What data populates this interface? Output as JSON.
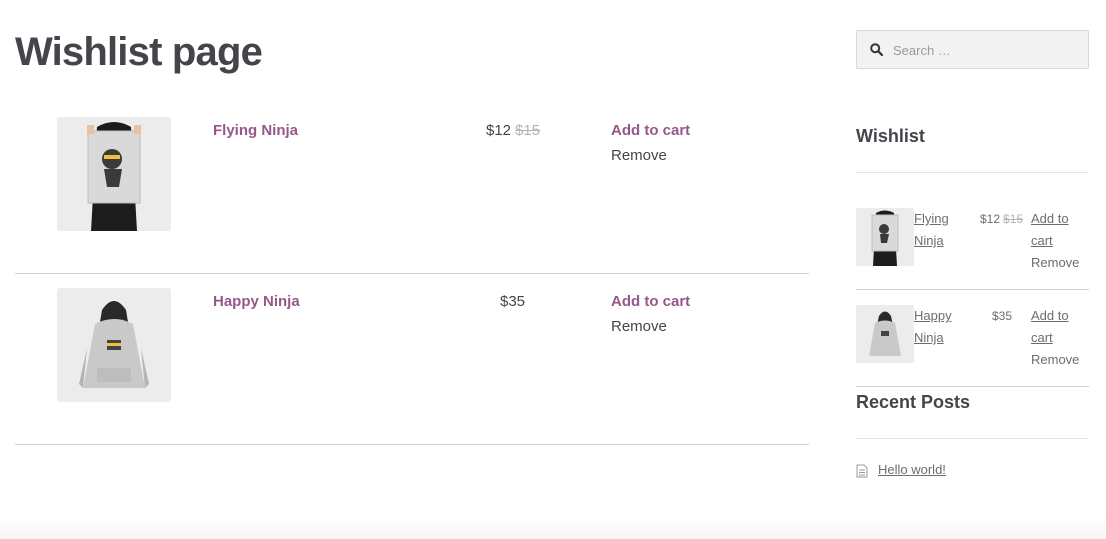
{
  "page": {
    "title": "Wishlist page"
  },
  "items": [
    {
      "name": "Flying Ninja",
      "price": "$12",
      "old_price": "$15",
      "add_label": "Add to cart",
      "remove_label": "Remove"
    },
    {
      "name": "Happy Ninja",
      "price": "$35",
      "old_price": "",
      "add_label": "Add to cart",
      "remove_label": "Remove"
    }
  ],
  "sidebar": {
    "search": {
      "placeholder": "Search …",
      "value": ""
    },
    "wishlist": {
      "title": "Wishlist",
      "items": [
        {
          "name": "Flying Ninja",
          "price": "$12",
          "old_price": "$15",
          "add_label": "Add to cart",
          "remove_label": "Remove"
        },
        {
          "name": "Happy Ninja",
          "price": "$35",
          "old_price": "",
          "add_label": "Add to cart",
          "remove_label": "Remove"
        }
      ]
    },
    "recent_posts": {
      "title": "Recent Posts",
      "posts": [
        {
          "label": "Hello world!"
        }
      ]
    }
  },
  "colors": {
    "accent": "#96588a",
    "text": "#43454b",
    "muted": "#6d6d6d",
    "strike": "#b3b3b3"
  }
}
